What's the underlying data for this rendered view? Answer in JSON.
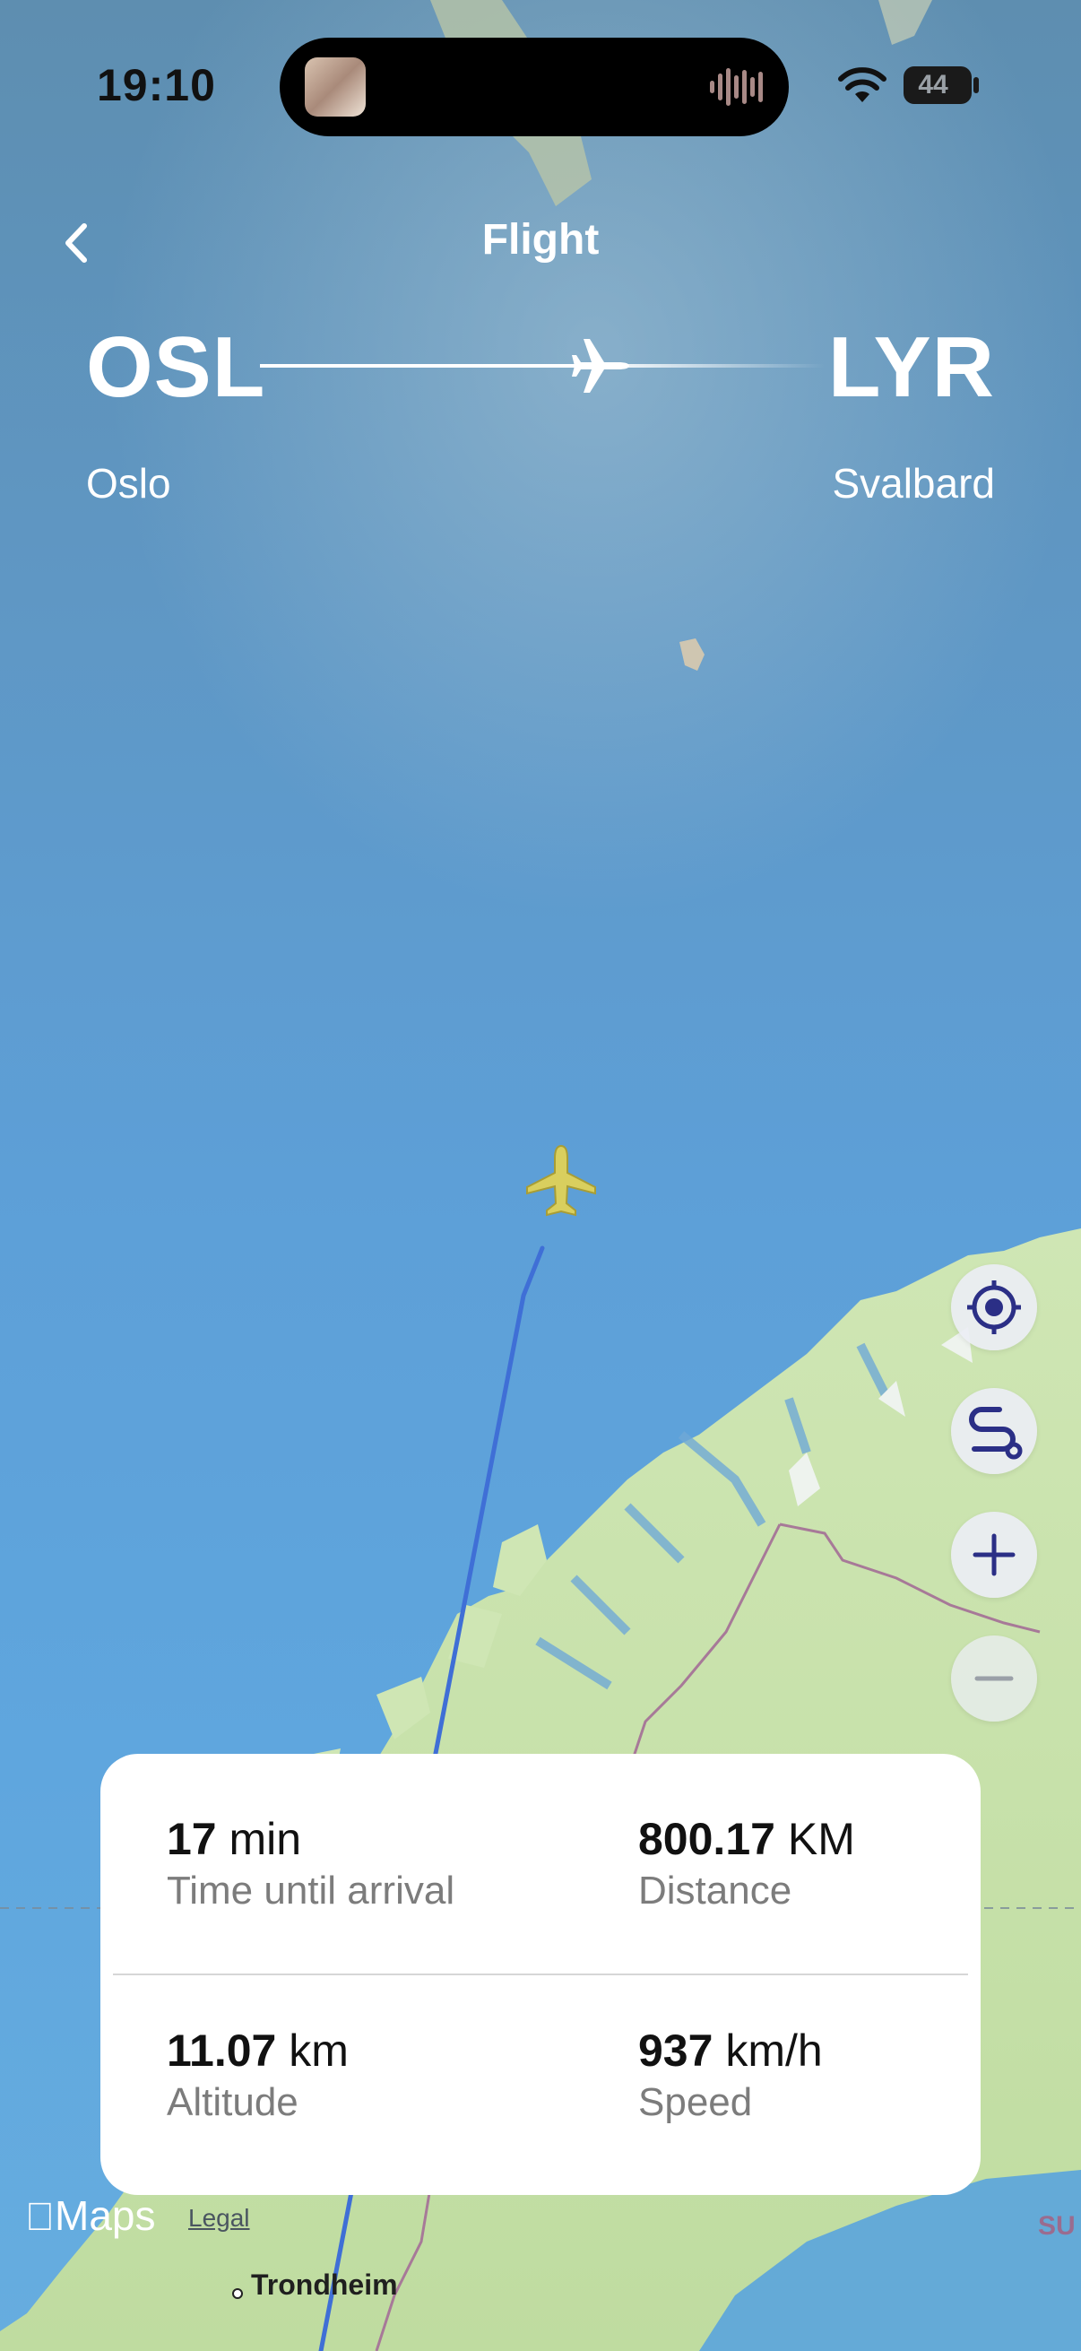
{
  "status_bar": {
    "time": "19:10",
    "battery": "44"
  },
  "header": {
    "title": "Flight",
    "back_icon": "chevron-left-icon"
  },
  "route": {
    "origin_code": "OSL",
    "origin_city": "Oslo",
    "destination_code": "LYR",
    "destination_city": "Svalbard",
    "progress": 0.75
  },
  "map_controls": [
    {
      "name": "locate-button",
      "icon": "crosshair-icon"
    },
    {
      "name": "route-button",
      "icon": "route-icon"
    },
    {
      "name": "zoom-in-button",
      "icon": "plus-icon"
    },
    {
      "name": "zoom-out-button",
      "icon": "minus-icon"
    }
  ],
  "stats": {
    "time_until_arrival": {
      "value": "17",
      "unit": "min",
      "label": "Time until arrival"
    },
    "distance": {
      "value": "800.17",
      "unit": "KM",
      "label": "Distance"
    },
    "altitude": {
      "value": "11.07",
      "unit": "km",
      "label": "Altitude"
    },
    "speed": {
      "value": "937",
      "unit": "km/h",
      "label": "Speed"
    }
  },
  "attribution": {
    "maps_label": "Maps",
    "legal_label": "Legal"
  },
  "map_labels": {
    "city": "Trondheim",
    "edge": "SU"
  },
  "colors": {
    "accent": "#2b2f86",
    "flight_path": "#3f6fd6",
    "plane": "#d9cf5e"
  }
}
